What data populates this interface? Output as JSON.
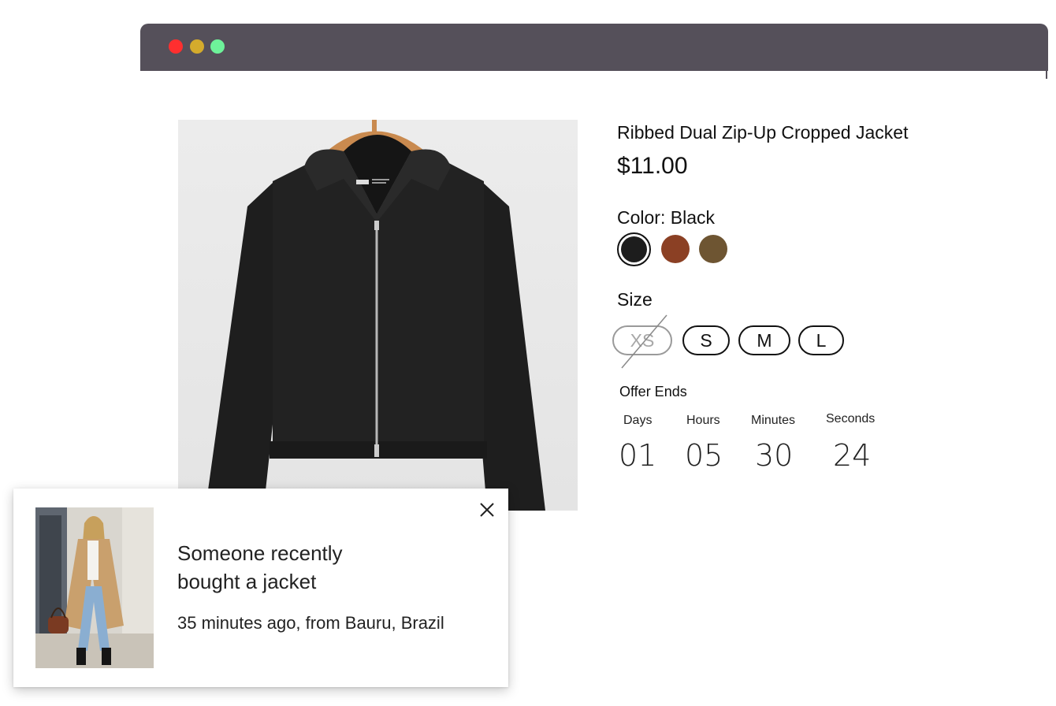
{
  "window": {
    "controls": [
      "close-dot",
      "minimize-dot",
      "maximize-dot"
    ]
  },
  "product": {
    "title": "Ribbed Dual Zip-Up Cropped Jacket",
    "price": "$11.00",
    "color_label": "Color: Black",
    "colors": [
      {
        "name": "Black",
        "hex": "#1d1d1d",
        "selected": true
      },
      {
        "name": "Brown",
        "hex": "#8b4024",
        "selected": false
      },
      {
        "name": "Olive",
        "hex": "#6e5532",
        "selected": false
      }
    ],
    "size_label": "Size",
    "sizes": [
      {
        "label": "XS",
        "available": false
      },
      {
        "label": "S",
        "available": true
      },
      {
        "label": "M",
        "available": true
      },
      {
        "label": "L",
        "available": true
      }
    ]
  },
  "countdown": {
    "title": "Offer Ends",
    "units": [
      {
        "label": "Days",
        "value": "01"
      },
      {
        "label": "Hours",
        "value": "05"
      },
      {
        "label": "Minutes",
        "value": "30"
      },
      {
        "label": "Seconds",
        "value": "24"
      }
    ]
  },
  "notification": {
    "title": "Someone recently bought a jacket",
    "subtitle": "35 minutes ago, from Bauru, Brazil",
    "close_icon": "close-icon"
  }
}
